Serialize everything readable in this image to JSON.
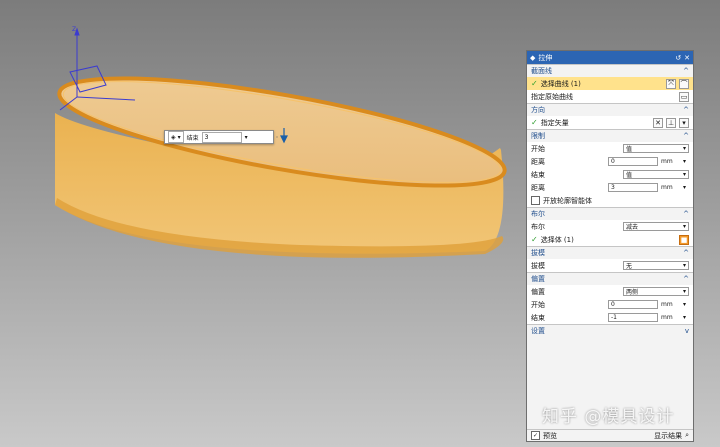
{
  "floating_input": {
    "direction_label": "结束",
    "value": "3"
  },
  "dialog": {
    "title": "拉伸",
    "sections": {
      "section": {
        "header": "截面线",
        "select_curve": "选择曲线 (1)",
        "specify_origin": "指定原始曲线"
      },
      "direction": {
        "header": "方向",
        "specify_vector": "指定矢量"
      },
      "limits": {
        "header": "限制",
        "start_label": "开始",
        "start_value": "值",
        "distance1_label": "距离",
        "distance1_value": "0",
        "distance1_unit": "mm",
        "end_label": "结束",
        "end_value": "值",
        "distance2_label": "距离",
        "distance2_value": "3",
        "distance2_unit": "mm",
        "open_profile": "开放轮廓智能体"
      },
      "boolean": {
        "header": "布尔",
        "boolean_label": "布尔",
        "boolean_value": "减去",
        "select_body": "选择体 (1)"
      },
      "draft": {
        "header": "拔模",
        "draft_label": "拔模",
        "draft_value": "无"
      },
      "offset": {
        "header": "偏置",
        "offset_label": "偏置",
        "offset_value": "两侧",
        "start_label": "开始",
        "start_value": "0",
        "start_unit": "mm",
        "end_label": "结束",
        "end_value": "-1",
        "end_unit": "mm"
      },
      "settings": {
        "header": "设置"
      }
    },
    "preview_label": "预览",
    "show_result_label": "显示结果"
  },
  "watermark": "知乎 @模具设计",
  "colors": {
    "accent": "#2c65b3",
    "highlight": "#ffe28c",
    "part": "#f5b441"
  }
}
